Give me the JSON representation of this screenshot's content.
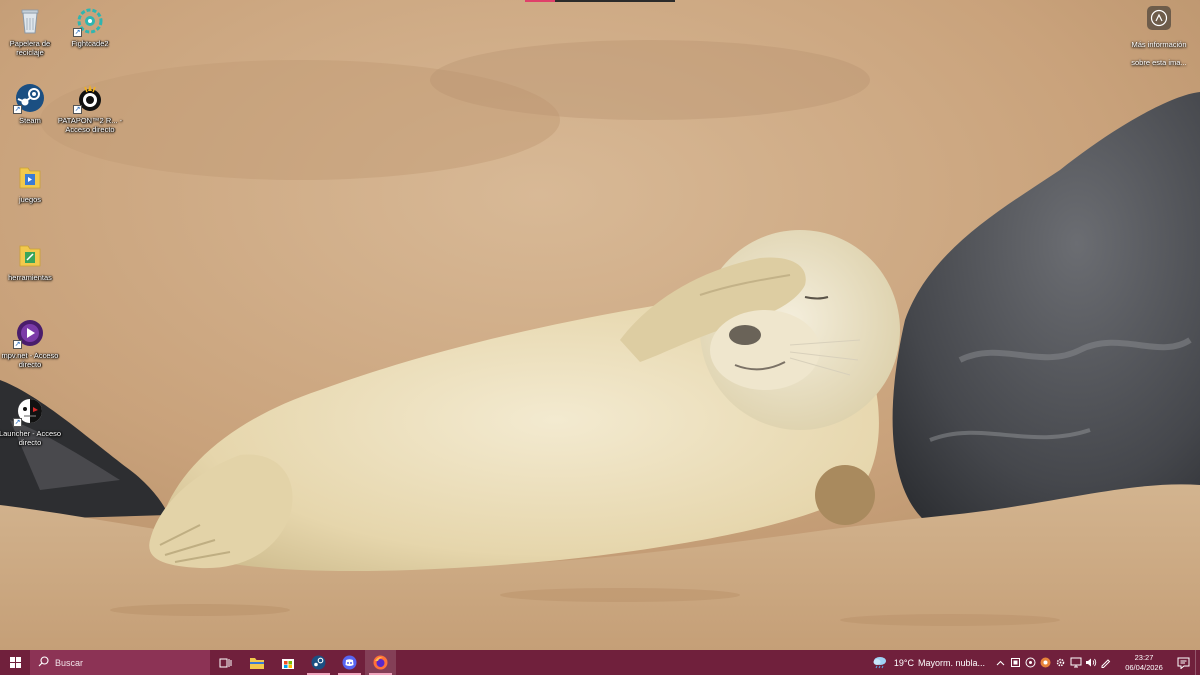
{
  "desktop": {
    "icons": [
      {
        "label": "Papelera de reciclaje",
        "icon": "recycle-bin-icon"
      },
      {
        "label": "Fightcade2",
        "icon": "fightcade-icon"
      },
      {
        "label": "Steam",
        "icon": "steam-icon"
      },
      {
        "label": "PATAPON™2 R... - Acceso directo",
        "icon": "patapon-icon"
      },
      {
        "label": "juegos",
        "icon": "folder-icon"
      },
      {
        "label": "herramientas",
        "icon": "folder-icon"
      },
      {
        "label": "mpv.net - Acceso directo",
        "icon": "mpvnet-icon"
      },
      {
        "label": "Launcher - Acceso directo",
        "icon": "launcher-icon"
      }
    ],
    "info": {
      "label": "Más información sobre esta ima...",
      "icon": "camera-info-icon"
    }
  },
  "taskbar": {
    "search_placeholder": "Buscar",
    "apps": [
      {
        "name": "task-view",
        "icon": "task-view-icon"
      },
      {
        "name": "file-explorer",
        "icon": "folder-icon"
      },
      {
        "name": "microsoft-store",
        "icon": "store-icon"
      },
      {
        "name": "steam",
        "icon": "steam-icon"
      },
      {
        "name": "discord",
        "icon": "discord-icon"
      },
      {
        "name": "firefox",
        "icon": "firefox-icon"
      }
    ],
    "weather": {
      "temp": "19°C",
      "condition": "Mayorm. nubla..."
    },
    "tray_chevron": "^",
    "clock": {
      "time": "23:27",
      "date": "06/04/2026"
    }
  },
  "colors": {
    "taskbar": "#70203c",
    "search": "#8c3355",
    "accent": "#e0406a"
  }
}
